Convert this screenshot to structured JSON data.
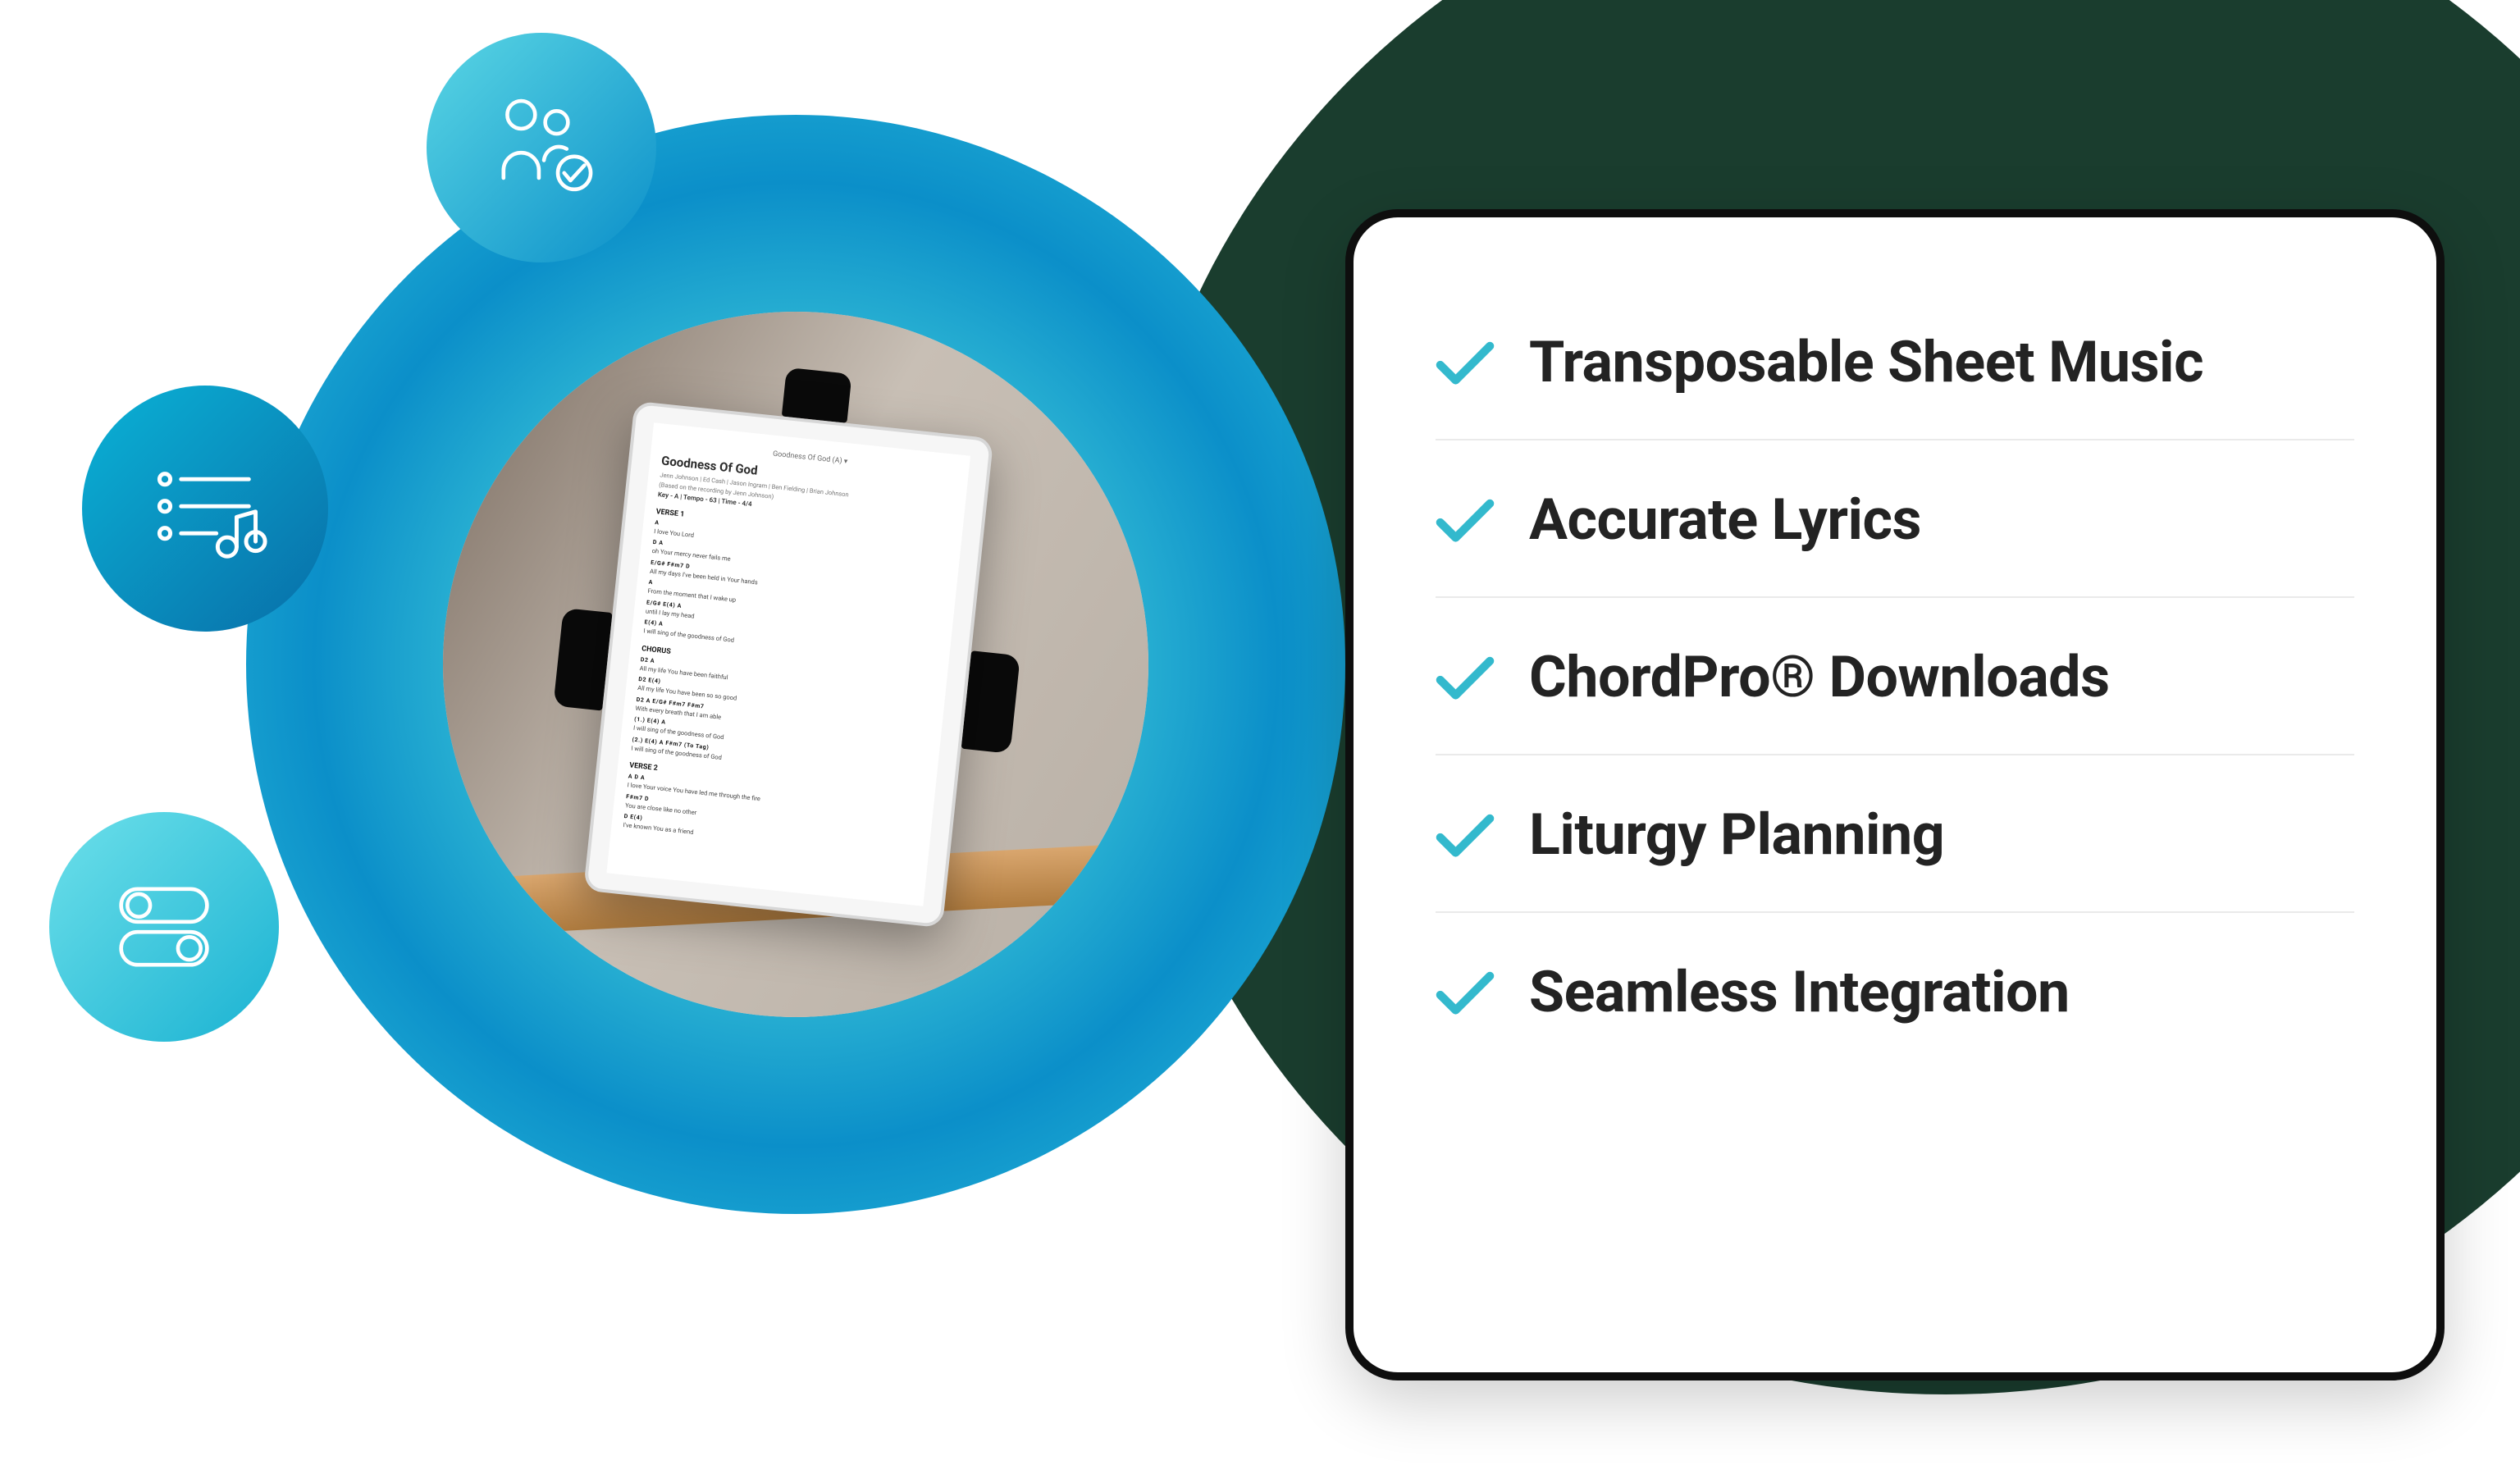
{
  "colors": {
    "accent_cyan": "#34bdd6",
    "accent_blue": "#0b8fc9",
    "dark_green": "#1a3d2e",
    "text_dark": "#232323",
    "check_stroke": "#33b9cd"
  },
  "orbit_icons": {
    "top": "people-check-icon",
    "mid": "playlist-music-icon",
    "bottom": "toggles-icon"
  },
  "tablet_sheet": {
    "nav_title": "Goodness Of God (A) ▾",
    "title": "Goodness Of God",
    "credits": "Jenn Johnson | Ed Cash | Jason Ingram | Ben Fielding | Brian Johnson",
    "based_on": "(Based on the recording by Jenn Johnson)",
    "meta": "Key - A | Tempo - 63 | Time - 4/4",
    "sections": [
      {
        "label": "VERSE 1",
        "lines": [
          {
            "chords": "A",
            "lyric": "I love You Lord"
          },
          {
            "chords": "D               A",
            "lyric": "oh Your mercy never fails me"
          },
          {
            "chords": "E/G#      F#m7           D",
            "lyric": "All    my days    I've been held in Your hands"
          },
          {
            "chords": "A",
            "lyric": "From the moment that I wake up"
          },
          {
            "chords": "E/G#                                      E(4)   A",
            "lyric": "                                    until I lay my head"
          },
          {
            "chords": "E(4)                  A",
            "lyric": "I will sing of the goodness of God"
          }
        ]
      },
      {
        "label": "CHORUS",
        "lines": [
          {
            "chords": "D2                            A",
            "lyric": "All my life You have been faithful"
          },
          {
            "chords": "D2                                E(4)",
            "lyric": "All my life You have been so so good"
          },
          {
            "chords": "D2                            A   E/G#  F#m7  F#m7",
            "lyric": "With every breath that I am able"
          },
          {
            "chords": "(1.)            E(4)              A",
            "lyric": "I will sing of the goodness of God"
          },
          {
            "chords": "(2.)            E(4)              A     F#m7    (To Tag)",
            "lyric": "I will sing of the goodness of God"
          }
        ]
      },
      {
        "label": "VERSE 2",
        "lines": [
          {
            "chords": "A                         D                 A",
            "lyric": "I love Your voice   You have led me through the fire"
          },
          {
            "chords": "F#m7              D",
            "lyric": "You are close like no other"
          },
          {
            "chords": "D                                                E(4)",
            "lyric": "                                 I've known You as a friend"
          }
        ]
      }
    ]
  },
  "features": [
    {
      "label": "Transposable Sheet Music"
    },
    {
      "label": "Accurate Lyrics"
    },
    {
      "label": "ChordPro® Downloads"
    },
    {
      "label": "Liturgy Planning"
    },
    {
      "label": "Seamless Integration"
    }
  ]
}
